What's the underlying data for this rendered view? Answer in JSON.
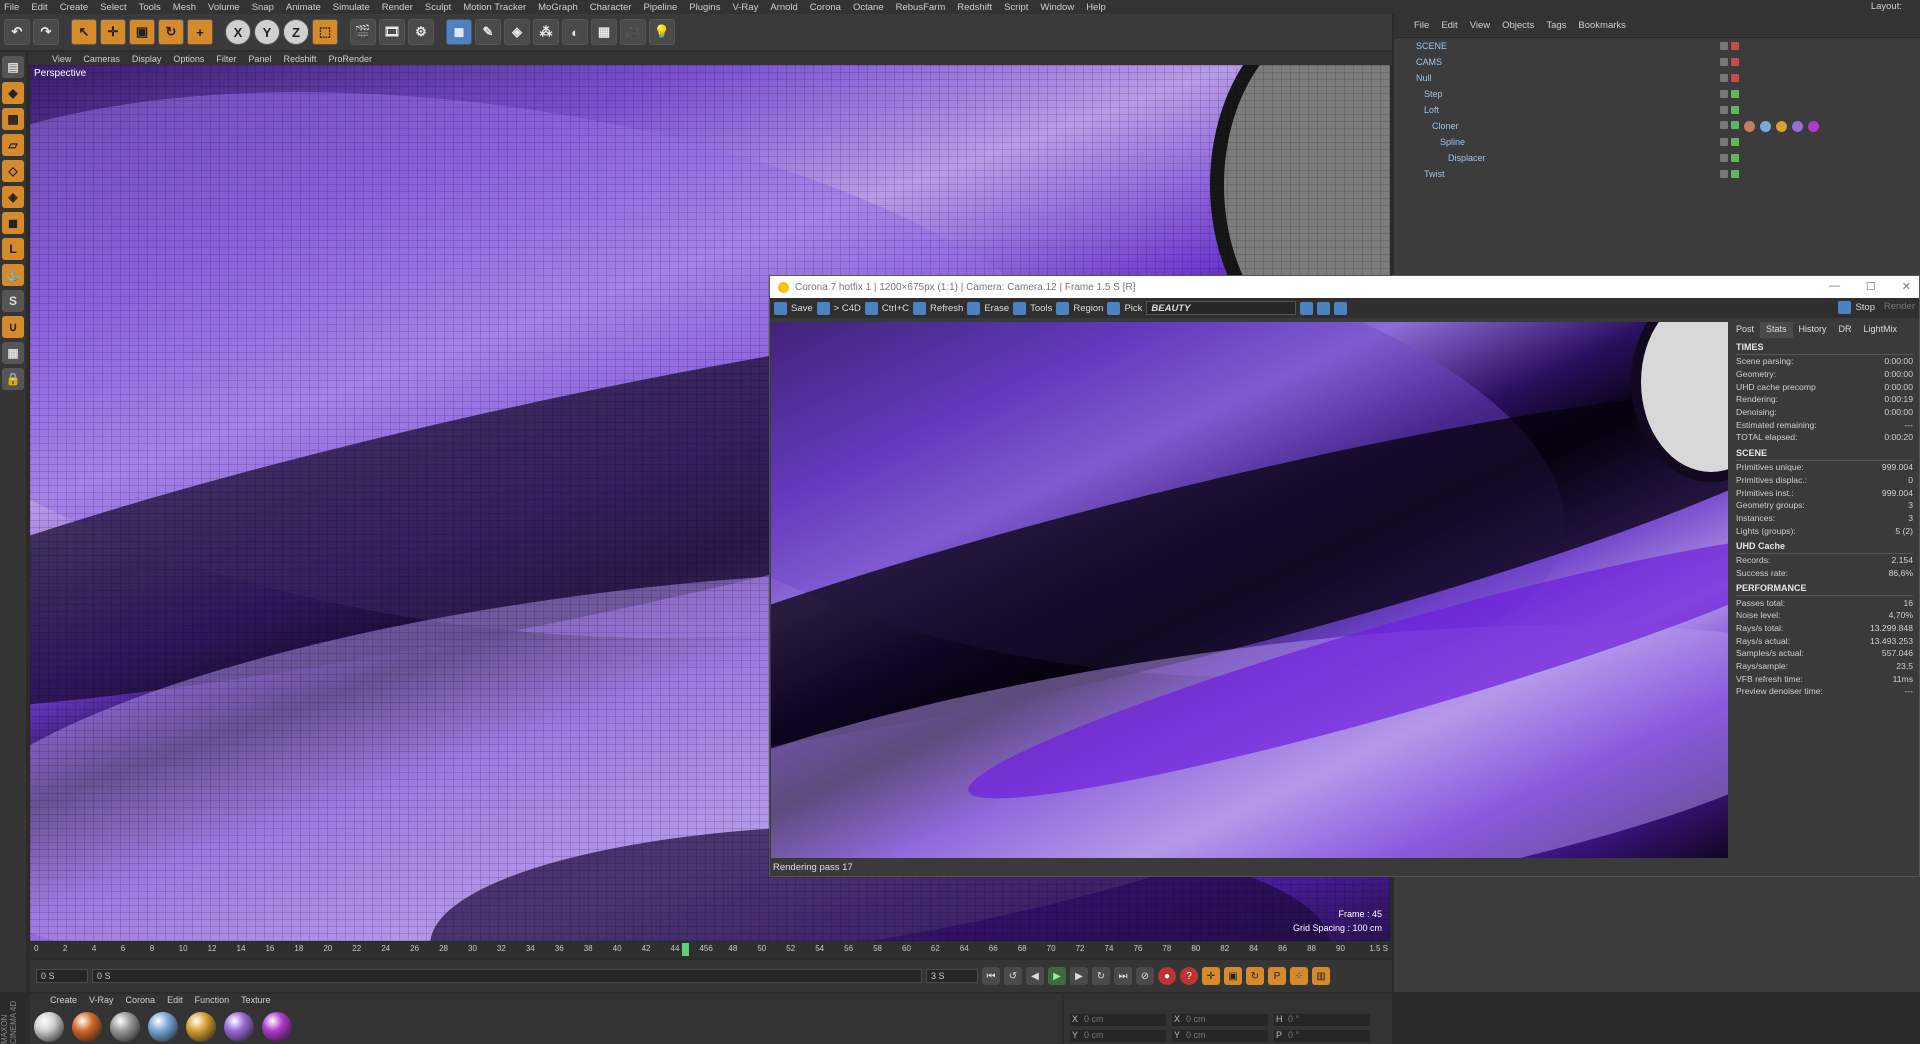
{
  "menubar": [
    "File",
    "Edit",
    "Create",
    "Select",
    "Tools",
    "Mesh",
    "Volume",
    "Snap",
    "Animate",
    "Simulate",
    "Render",
    "Sculpt",
    "Motion Tracker",
    "MoGraph",
    "Character",
    "Pipeline",
    "Plugins",
    "V-Ray",
    "Arnold",
    "Corona",
    "Octane",
    "RebusFarm",
    "Redshift",
    "Script",
    "Window",
    "Help"
  ],
  "layout_label": "Layout:",
  "viewport": {
    "menu": [
      "View",
      "Cameras",
      "Display",
      "Options",
      "Filter",
      "Panel",
      "Redshift",
      "ProRender"
    ],
    "label": "Perspective",
    "frame": "Frame : 45",
    "grid": "Grid Spacing : 100 cm"
  },
  "objects": {
    "menu": [
      "File",
      "Edit",
      "View",
      "Objects",
      "Tags",
      "Bookmarks"
    ],
    "rows": [
      {
        "name": "SCENE",
        "indent": 0
      },
      {
        "name": "CAMS",
        "indent": 0
      },
      {
        "name": "Null",
        "indent": 0
      },
      {
        "name": "Step",
        "indent": 1
      },
      {
        "name": "Loft",
        "indent": 1
      },
      {
        "name": "Cloner",
        "indent": 2
      },
      {
        "name": "Spline",
        "indent": 3
      },
      {
        "name": "Displacer",
        "indent": 4
      },
      {
        "name": "Twist",
        "indent": 1
      }
    ]
  },
  "timeline": {
    "ticks": [
      "0",
      "2",
      "4",
      "6",
      "8",
      "10",
      "12",
      "14",
      "16",
      "18",
      "20",
      "22",
      "24",
      "26",
      "28",
      "30",
      "32",
      "34",
      "36",
      "38",
      "40",
      "42",
      "44",
      "456",
      "48",
      "50",
      "52",
      "54",
      "56",
      "58",
      "60",
      "62",
      "64",
      "66",
      "68",
      "70",
      "72",
      "74",
      "76",
      "78",
      "80",
      "82",
      "84",
      "86",
      "88",
      "90"
    ],
    "playhead": 45,
    "end_label": "1.5 S",
    "start_field": "0 S",
    "range_field": "0 S",
    "end_field": "3 S"
  },
  "materials": {
    "menu": [
      "Create",
      "V-Ray",
      "Corona",
      "Edit",
      "Function",
      "Texture"
    ],
    "colors": [
      "#cfcfcf",
      "#d36a2a",
      "#9a9a9a",
      "#7aa8d8",
      "#d8a030",
      "#9a6ad8",
      "#b03ad0"
    ]
  },
  "coords": {
    "rows": [
      [
        {
          "k": "X",
          "v": "0 cm"
        },
        {
          "k": "X",
          "v": "0 cm"
        },
        {
          "k": "H",
          "v": "0 °"
        }
      ],
      [
        {
          "k": "Y",
          "v": "0 cm"
        },
        {
          "k": "Y",
          "v": "0 cm"
        },
        {
          "k": "P",
          "v": "0 °"
        }
      ]
    ]
  },
  "side_brand": "MAXON CINEMA 4D",
  "vfb": {
    "title": "Corona 7 hotfix 1 | 1200×675px (1:1) | Camera: Camera.12 | Frame 1.5 S [R]",
    "tools": [
      "Save",
      "> C4D",
      "Ctrl+C",
      "Refresh",
      "Erase",
      "Tools",
      "Region",
      "Pick"
    ],
    "channel": "BEAUTY",
    "stop": "Stop",
    "render": "Render",
    "status": "Rendering pass 17",
    "tabs": [
      "Post",
      "Stats",
      "History",
      "DR",
      "LightMix"
    ],
    "active_tab": "Stats",
    "sections": [
      {
        "title": "TIMES",
        "rows": [
          [
            "Scene parsing:",
            "0:00:00"
          ],
          [
            "Geometry:",
            "0:00:00"
          ],
          [
            "UHD cache precomp",
            "0:00:00"
          ],
          [
            "Rendering:",
            "0:00:19"
          ],
          [
            "Denoising:",
            "0:00:00"
          ],
          [
            "Estimated remaining:",
            "---"
          ],
          [
            "TOTAL elapsed:",
            "0:00:20"
          ]
        ]
      },
      {
        "title": "SCENE",
        "rows": [
          [
            "Primitives unique:",
            "999.004"
          ],
          [
            "Primitives displac.:",
            "0"
          ],
          [
            "Primitives inst.:",
            "999.004"
          ],
          [
            "Geometry groups:",
            "3"
          ],
          [
            "Instances:",
            "3"
          ],
          [
            "Lights (groups):",
            "5 (2)"
          ]
        ]
      },
      {
        "title": "UHD Cache",
        "rows": [
          [
            "Records:",
            "2.154"
          ],
          [
            "Success rate:",
            "86,6%"
          ]
        ]
      },
      {
        "title": "PERFORMANCE",
        "rows": [
          [
            "Passes total:",
            "16"
          ],
          [
            "Noise level:",
            "4,70%"
          ],
          [
            "Rays/s total:",
            "13.299.848"
          ],
          [
            "Rays/s actual:",
            "13.493.253"
          ],
          [
            "Samples/s actual:",
            "557.046"
          ],
          [
            "Rays/sample:",
            "23,5"
          ],
          [
            "VFB refresh time:",
            "11ms"
          ],
          [
            "Preview denoiser time:",
            "---"
          ]
        ]
      }
    ]
  }
}
